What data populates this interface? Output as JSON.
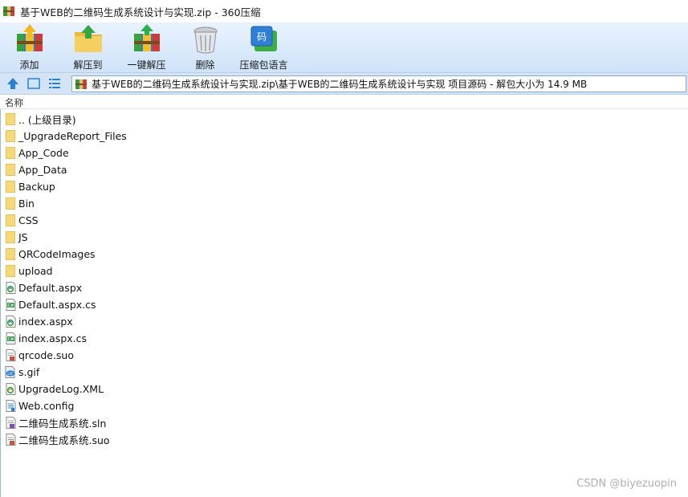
{
  "window": {
    "title": "基于WEB的二维码生成系统设计与实现.zip - 360压缩"
  },
  "toolbar": {
    "buttons": [
      {
        "label": "添加",
        "icon": "add-archive-icon"
      },
      {
        "label": "解压到",
        "icon": "extract-to-icon"
      },
      {
        "label": "一键解压",
        "icon": "one-click-extract-icon"
      },
      {
        "label": "删除",
        "icon": "delete-bin-icon"
      },
      {
        "label": "压缩包语言",
        "icon": "archive-language-icon"
      }
    ]
  },
  "addressbar": {
    "path": "基于WEB的二维码生成系统设计与实现.zip\\基于WEB的二维码生成系统设计与实现 项目源码 - 解包大小为 14.9 MB"
  },
  "list": {
    "column_name": "名称",
    "items": [
      {
        "name": ".. (上级目录)",
        "type": "folder"
      },
      {
        "name": "_UpgradeReport_Files",
        "type": "folder"
      },
      {
        "name": "App_Code",
        "type": "folder"
      },
      {
        "name": "App_Data",
        "type": "folder"
      },
      {
        "name": "Backup",
        "type": "folder"
      },
      {
        "name": "Bin",
        "type": "folder"
      },
      {
        "name": "CSS",
        "type": "folder"
      },
      {
        "name": "JS",
        "type": "folder"
      },
      {
        "name": "QRCodeImages",
        "type": "folder"
      },
      {
        "name": "upload",
        "type": "folder"
      },
      {
        "name": "Default.aspx",
        "type": "aspx"
      },
      {
        "name": "Default.aspx.cs",
        "type": "cs"
      },
      {
        "name": "index.aspx",
        "type": "aspx"
      },
      {
        "name": "index.aspx.cs",
        "type": "cs"
      },
      {
        "name": "qrcode.suo",
        "type": "suo"
      },
      {
        "name": "s.gif",
        "type": "gif"
      },
      {
        "name": "UpgradeLog.XML",
        "type": "xml"
      },
      {
        "name": "Web.config",
        "type": "config"
      },
      {
        "name": "二维码生成系统.sln",
        "type": "sln"
      },
      {
        "name": "二维码生成系统.suo",
        "type": "suo"
      }
    ]
  },
  "watermark": "CSDN @biyezuopin",
  "colors": {
    "toolbar_top": "#e9f3ff",
    "toolbar_bottom": "#cfe2f8",
    "folder": "#f5d36b",
    "accent_blue": "#2a7fd4"
  }
}
